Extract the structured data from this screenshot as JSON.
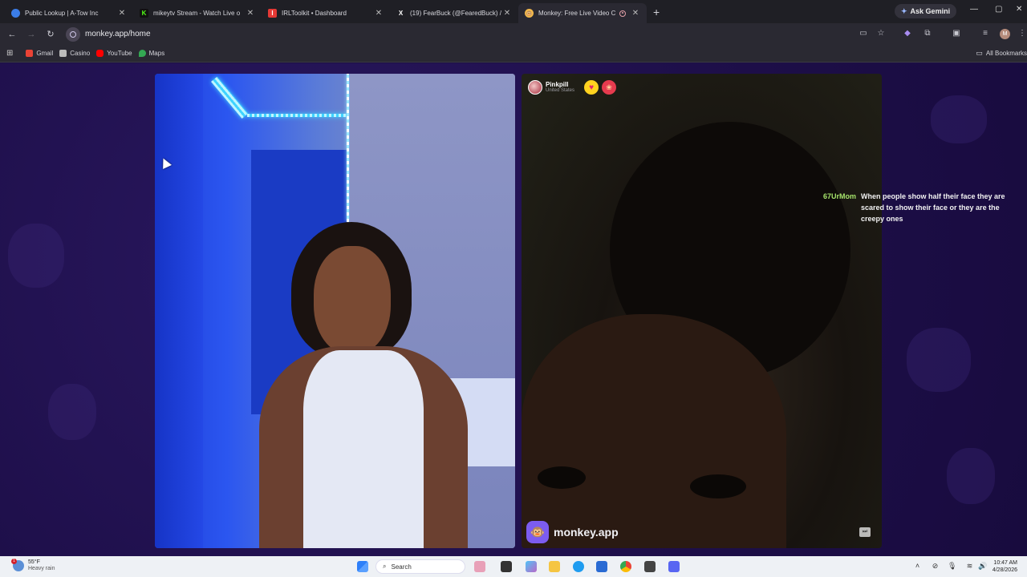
{
  "browser": {
    "tabs": [
      {
        "title": "Public Lookup | A-Tow Inc",
        "icon": "globe-icon",
        "color": "#3b7de8",
        "active": false
      },
      {
        "title": "mikeytv Stream - Watch Live o",
        "icon": "kick-icon",
        "color": "#53fc18",
        "active": false
      },
      {
        "title": "IRLToolkit • Dashboard",
        "icon": "irltoolkit-icon",
        "color": "#e53935",
        "active": false
      },
      {
        "title": "(19) FearBuck (@FearedBuck) /",
        "icon": "x-icon",
        "color": "#ffffff",
        "active": false
      },
      {
        "title": "Monkey: Free Live Video C",
        "icon": "monkey-icon",
        "color": "#f2b84b",
        "active": true
      }
    ],
    "new_tab": "+",
    "ask_gemini": "Ask Gemini",
    "window_controls": {
      "minimize": "—",
      "maximize": "▢",
      "close": "✕"
    },
    "url": "monkey.app/home",
    "bookmarks": [
      {
        "label": "Gmail",
        "icon": "gmail-icon",
        "color": "#ea4335"
      },
      {
        "label": "Casino",
        "icon": "casino-icon",
        "color": "#bbbbbb"
      },
      {
        "label": "YouTube",
        "icon": "youtube-icon",
        "color": "#ff0000"
      },
      {
        "label": "Maps",
        "icon": "maps-icon",
        "color": "#34a853"
      }
    ],
    "all_bookmarks": "All Bookmarks"
  },
  "call": {
    "remote_user": {
      "name": "Pinkpill",
      "country": "United States"
    },
    "brand": "monkey.app",
    "chat": [
      {
        "user": "67UrMom",
        "message": "When people show half their face they are scared to show their face or they are the creepy ones"
      }
    ]
  },
  "taskbar": {
    "weather": {
      "temp": "55°F",
      "condition": "Heavy rain",
      "alerts": "1"
    },
    "search_placeholder": "Search",
    "time": "10:47 AM",
    "date": "4/28/2026"
  }
}
